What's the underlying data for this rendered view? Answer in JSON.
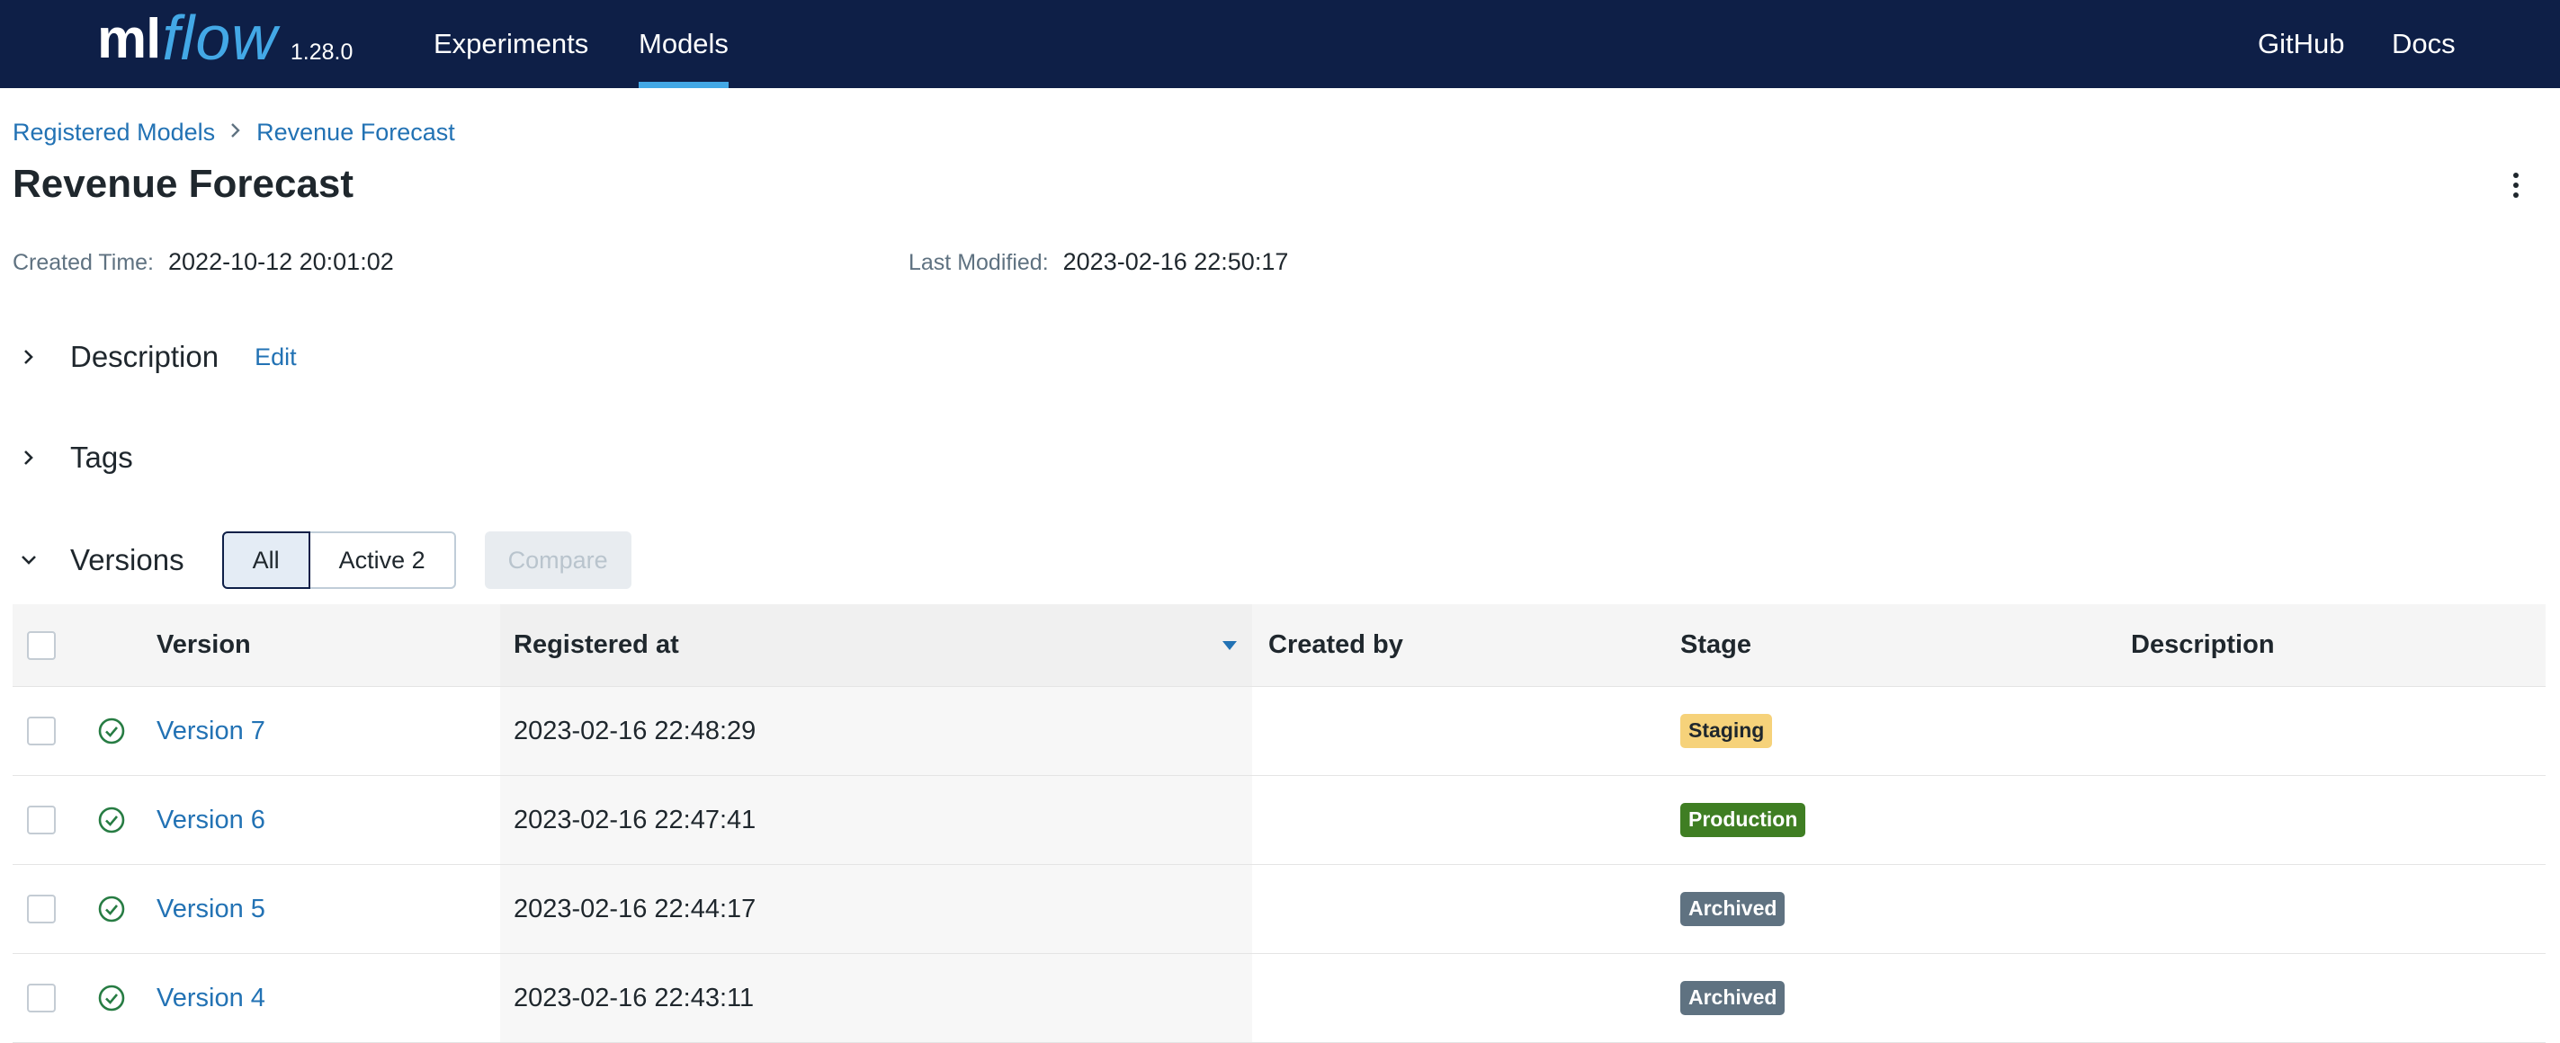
{
  "nav": {
    "logo_ml": "ml",
    "logo_flow": "flow",
    "version": "1.28.0",
    "items": [
      {
        "label": "Experiments"
      },
      {
        "label": "Models"
      },
      {
        "label": "GitHub"
      },
      {
        "label": "Docs"
      }
    ],
    "active": "Models"
  },
  "breadcrumb": {
    "items": [
      {
        "label": "Registered Models"
      },
      {
        "label": "Revenue Forecast"
      }
    ]
  },
  "page": {
    "title": "Revenue Forecast",
    "created_label": "Created Time:",
    "created_value": "2022-10-12 20:01:02",
    "modified_label": "Last Modified:",
    "modified_value": "2023-02-16 22:50:17"
  },
  "sections": {
    "description": {
      "title": "Description",
      "edit_label": "Edit"
    },
    "tags": {
      "title": "Tags"
    },
    "versions": {
      "title": "Versions",
      "filter_all": "All",
      "filter_active": "Active 2",
      "compare_label": "Compare"
    }
  },
  "table": {
    "columns": [
      "Version",
      "Registered at",
      "Created by",
      "Stage",
      "Description"
    ],
    "rows": [
      {
        "version": "Version 7",
        "registered": "2023-02-16 22:48:29",
        "created_by": "",
        "stage": "Staging",
        "description": ""
      },
      {
        "version": "Version 6",
        "registered": "2023-02-16 22:47:41",
        "created_by": "",
        "stage": "Production",
        "description": ""
      },
      {
        "version": "Version 5",
        "registered": "2023-02-16 22:44:17",
        "created_by": "",
        "stage": "Archived",
        "description": ""
      },
      {
        "version": "Version 4",
        "registered": "2023-02-16 22:43:11",
        "created_by": "",
        "stage": "Archived",
        "description": ""
      }
    ]
  },
  "colors": {
    "topbar": "#0e1f47",
    "accent": "#43a8e6",
    "link": "#2272b4",
    "stage_staging_bg": "#f6d27a",
    "stage_staging_fg": "#1f272d",
    "stage_production_bg": "#3f7e23",
    "stage_archived_bg": "#5f7281",
    "status_ready": "#277c43"
  }
}
